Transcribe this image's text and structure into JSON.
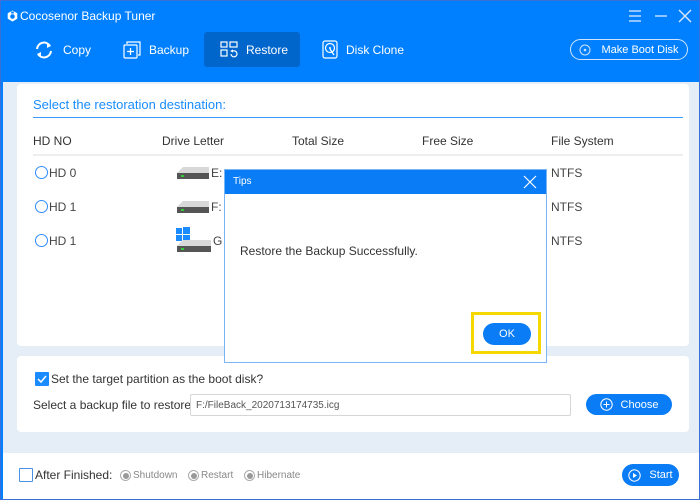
{
  "app": {
    "title": "Cocosenor Backup Tuner",
    "accent": "#0080ff"
  },
  "window_controls": {
    "menu": "menu-icon",
    "minimize": "minimize-icon",
    "close": "close-icon"
  },
  "nav": {
    "items": [
      {
        "label": "Copy",
        "icon": "sync-icon",
        "active": false
      },
      {
        "label": "Backup",
        "icon": "backup-icon",
        "active": false
      },
      {
        "label": "Restore",
        "icon": "restore-icon",
        "active": true
      },
      {
        "label": "Disk Clone",
        "icon": "disk-clone-icon",
        "active": false
      }
    ],
    "make_boot_disk": "Make Boot Disk"
  },
  "destination": {
    "title": "Select the restoration destination:",
    "columns": [
      "HD NO",
      "Drive Letter",
      "Total Size",
      "Free Size",
      "File System"
    ],
    "rows": [
      {
        "hd": "HD 0",
        "letter": "E:",
        "total": "",
        "free": "",
        "fs": "NTFS",
        "system_drive": false
      },
      {
        "hd": "HD 1",
        "letter": "F:",
        "total": "",
        "free": "",
        "fs": "NTFS",
        "system_drive": false
      },
      {
        "hd": "HD 1",
        "letter": "G",
        "total": "",
        "free": "",
        "fs": "NTFS",
        "system_drive": true
      }
    ]
  },
  "file_panel": {
    "boot_checkbox_label": "Set the target partition as the boot disk?",
    "boot_checked": true,
    "file_label": "Select a backup file to restore:",
    "file_value": "F:/FileBack_2020713174735.icg",
    "choose_label": "Choose"
  },
  "bottom": {
    "after_label": "After Finished:",
    "after_checked": false,
    "options": [
      "Shutdown",
      "Restart",
      "Hibernate"
    ],
    "start_label": "Start"
  },
  "dialog": {
    "title": "Tips",
    "message": "Restore the Backup Successfully.",
    "ok_label": "OK",
    "highlight_color": "#f5d800"
  }
}
